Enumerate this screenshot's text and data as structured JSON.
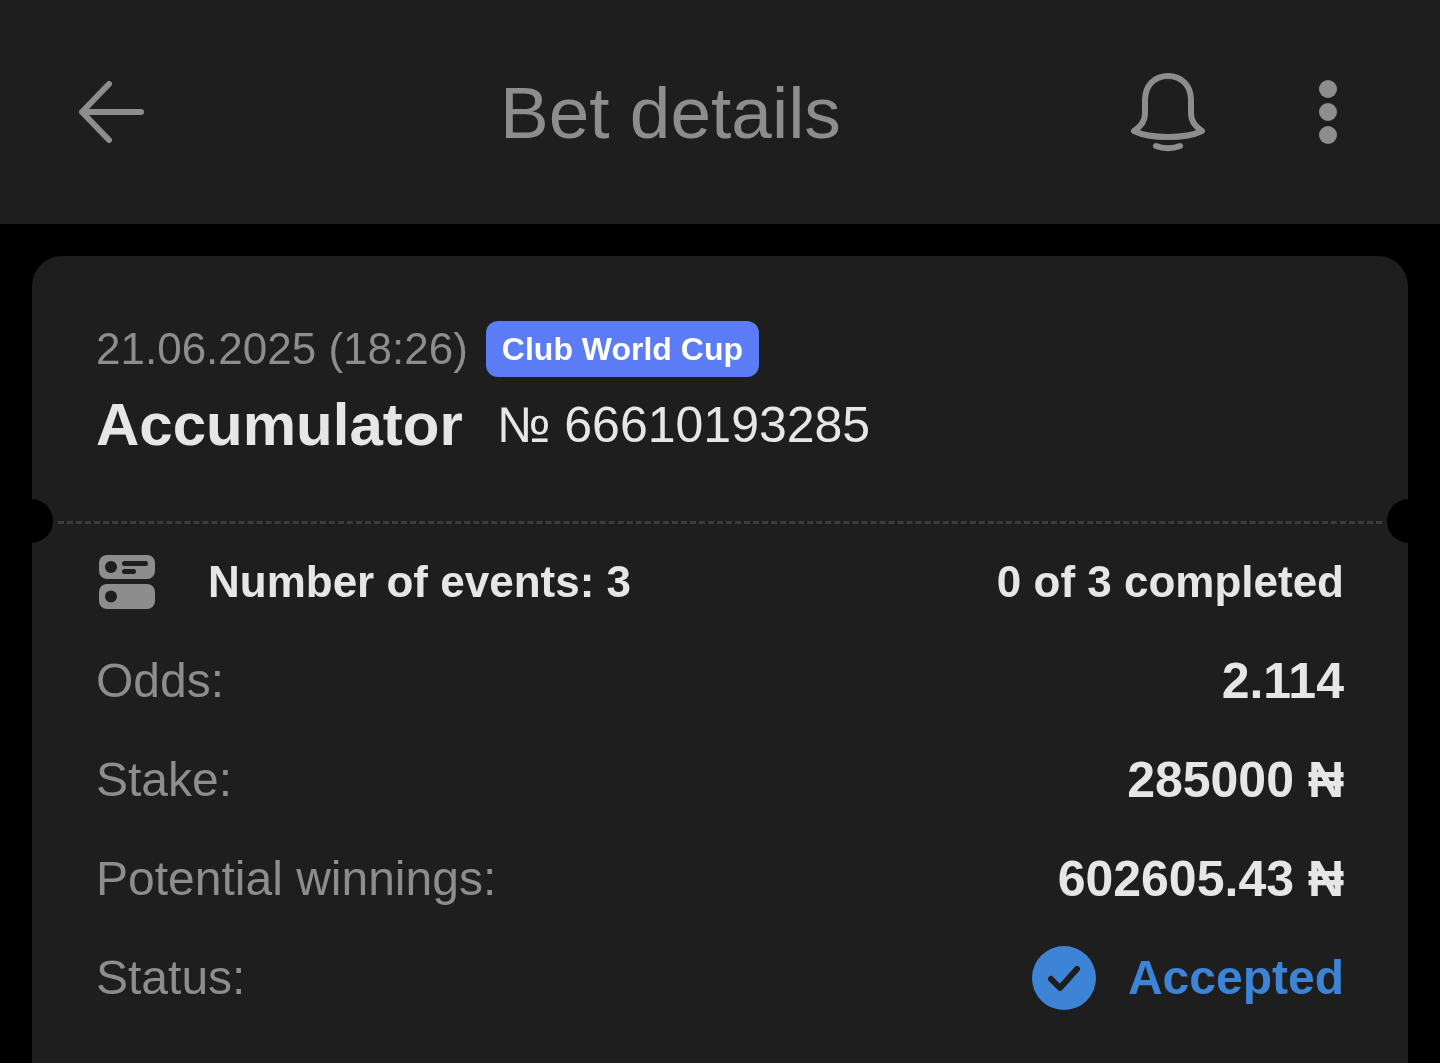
{
  "header": {
    "title": "Bet details"
  },
  "bet": {
    "date": "21.06.2025 (18:26)",
    "tag": "Club World Cup",
    "type": "Accumulator",
    "number": "№ 66610193285"
  },
  "events": {
    "label": "Number of events: 3",
    "completed_text": "0 of 3 completed"
  },
  "details": [
    {
      "kind": "value",
      "label": "Odds:",
      "value": "2.114"
    },
    {
      "kind": "value",
      "label": "Stake:",
      "value": "285000 ₦"
    },
    {
      "kind": "value",
      "label": "Potential winnings:",
      "value": "602605.43 ₦"
    },
    {
      "kind": "status",
      "label": "Status:",
      "value": "Accepted"
    }
  ]
}
